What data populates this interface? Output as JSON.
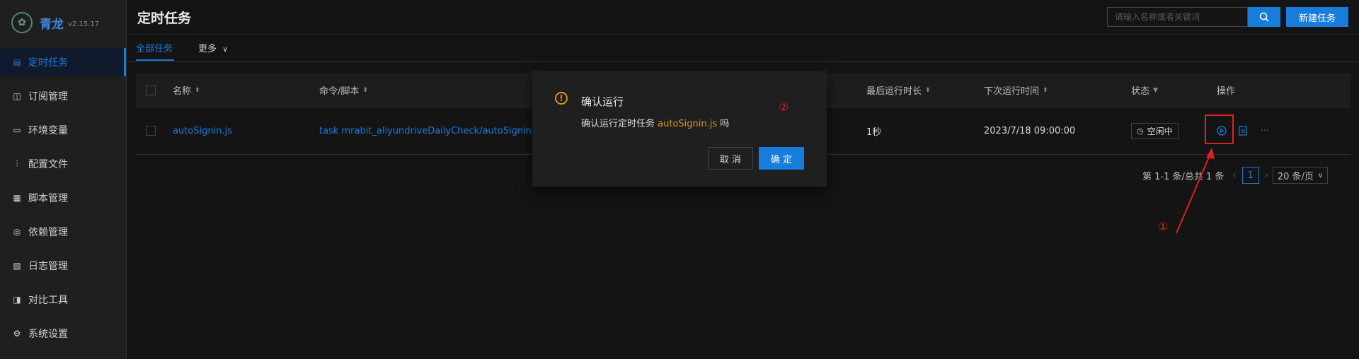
{
  "app": {
    "name": "青龙",
    "version": "v2.15.17"
  },
  "sidebar": {
    "items": [
      {
        "label": "定时任务",
        "icon": "calendar-icon"
      },
      {
        "label": "订阅管理",
        "icon": "subscription-icon"
      },
      {
        "label": "环境变量",
        "icon": "monitor-icon"
      },
      {
        "label": "配置文件",
        "icon": "sliders-icon"
      },
      {
        "label": "脚本管理",
        "icon": "script-icon"
      },
      {
        "label": "依赖管理",
        "icon": "dependency-icon"
      },
      {
        "label": "日志管理",
        "icon": "log-icon"
      },
      {
        "label": "对比工具",
        "icon": "diff-icon"
      },
      {
        "label": "系统设置",
        "icon": "gear-icon"
      }
    ]
  },
  "header": {
    "title": "定时任务",
    "search_placeholder": "请输入名称或者关键词",
    "new_button": "新建任务"
  },
  "tabs": {
    "all": "全部任务",
    "more": "更多"
  },
  "table": {
    "columns": [
      "名称",
      "命令/脚本",
      "最后运行时长",
      "下次运行时间",
      "状态",
      "操作"
    ],
    "rows": [
      {
        "name": "autoSignin.js",
        "command": "task mrabit_aliyundriveDailyCheck/autoSignin.js",
        "last_duration": "1秒",
        "next_run": "2023/7/18 09:00:00",
        "status": "空闲中"
      }
    ]
  },
  "pagination": {
    "summary": "第 1-1 条/总共 1 条",
    "current_page": "1",
    "page_size": "20 条/页"
  },
  "modal": {
    "title": "确认运行",
    "content_prefix": "确认运行定时任务",
    "script": "autoSignin.js",
    "content_suffix": "吗",
    "cancel": "取 消",
    "ok": "确 定"
  },
  "annotations": {
    "one": "①",
    "two": "②"
  },
  "colors": {
    "accent": "#177ddc",
    "warning": "#d89614",
    "highlight": "#e02020"
  }
}
